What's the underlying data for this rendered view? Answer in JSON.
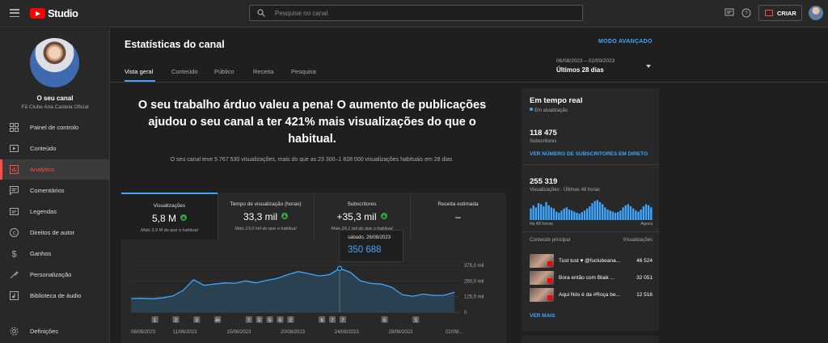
{
  "topbar": {
    "brand": "Studio",
    "search_placeholder": "Pesquise no canal",
    "create_label": "CRIAR"
  },
  "sidebar": {
    "channel_title": "O seu canal",
    "channel_name": "Fã Clube Ana Castela Oficial",
    "items": [
      {
        "label": "Painel de controlo",
        "icon": "dashboard-icon"
      },
      {
        "label": "Conteúdo",
        "icon": "content-icon"
      },
      {
        "label": "Analytics",
        "icon": "analytics-icon"
      },
      {
        "label": "Comentários",
        "icon": "comments-icon"
      },
      {
        "label": "Legendas",
        "icon": "subtitles-icon"
      },
      {
        "label": "Direitos de autor",
        "icon": "copyright-icon"
      },
      {
        "label": "Ganhos",
        "icon": "earn-icon"
      },
      {
        "label": "Personalização",
        "icon": "customization-icon"
      },
      {
        "label": "Biblioteca de áudio",
        "icon": "audio-library-icon"
      }
    ],
    "settings_label": "Definições"
  },
  "header": {
    "title": "Estatísticas do canal",
    "advanced_mode": "MODO AVANÇADO",
    "tabs": [
      "Vista geral",
      "Conteúdo",
      "Público",
      "Receita",
      "Pesquisa"
    ],
    "date_range": "06/08/2023 – 02/09/2023",
    "date_label": "Últimos 28 dias"
  },
  "headline": {
    "title": "O seu trabalho árduo valeu a pena! O aumento de publicações ajudou o seu canal a ter 421% mais visualizações do que o habitual.",
    "subtitle": "O seu canal teve 5 767 530 visualizações, mais do que as 23 300–1 828 000 visualizações habituais em 28 dias"
  },
  "metrics": [
    {
      "label": "Visualizações",
      "value": "5,8 M",
      "note": "Mais 3,9 M do que o habitual"
    },
    {
      "label": "Tempo de visualização (horas)",
      "value": "33,3 mil",
      "note": "Mais 23,0 mil do que o habitual"
    },
    {
      "label": "Subscritores",
      "value": "+35,3 mil",
      "note": "Mais 24,1 mil do que o habitual"
    },
    {
      "label": "Receita estimada",
      "value": "–",
      "note": ""
    }
  ],
  "tooltip": {
    "date": "sábado, 26/08/2023",
    "value": "350 688"
  },
  "chart_data": {
    "type": "area",
    "series": [
      {
        "values": [
          110,
          112,
          108,
          115,
          130,
          175,
          260,
          215,
          225,
          235,
          232,
          250,
          235,
          255,
          270,
          300,
          325,
          310,
          290,
          300,
          350,
          320,
          250,
          230,
          225,
          200,
          140,
          128,
          145,
          135,
          135,
          160
        ]
      }
    ],
    "ylim": [
      0,
      375
    ],
    "yticks": [
      "375,0 mil",
      "250,0 mil",
      "125,0 mil",
      "0"
    ],
    "xticks": [
      "06/08/2023",
      "11/08/2023",
      "15/08/2023",
      "20/08/2023",
      "24/08/2023",
      "29/08/2023",
      "02/09/..."
    ],
    "markers": [
      "1",
      "2",
      "3",
      "4+",
      "7",
      "5",
      "5",
      "6",
      "2",
      "6",
      "7",
      "7",
      "6",
      "1"
    ],
    "highlight_index": 20,
    "color": "#3ea6ff"
  },
  "realtime": {
    "title": "Em tempo real",
    "status": "Em atualização",
    "subscribers_value": "118 475",
    "subscribers_label": "Subscritores",
    "live_subs_link": "VER NÚMERO DE SUBSCRITORES EM DIRETO",
    "views_value": "255 319",
    "views_label": "Visualizações · Últimas 48 horas",
    "axis_left": "há 48 horas",
    "axis_right": "Agora",
    "bars": [
      55,
      70,
      60,
      80,
      75,
      65,
      85,
      70,
      60,
      55,
      40,
      35,
      45,
      55,
      60,
      50,
      45,
      40,
      35,
      30,
      38,
      45,
      55,
      65,
      80,
      90,
      95,
      85,
      75,
      60,
      50,
      45,
      40,
      35,
      38,
      45,
      60,
      70,
      75,
      65,
      55,
      45,
      40,
      50,
      65,
      75,
      70,
      60
    ],
    "col_content": "Conteúdo principal",
    "col_views": "Visualizações",
    "top_content": [
      {
        "title": "Tust tust ♥ @fuclubeana...",
        "views": "46 524"
      },
      {
        "title": "Bora então com Blaik ...",
        "views": "32 051"
      },
      {
        "title": "Aqui Nós é da #Roça be...",
        "views": "12 516"
      }
    ],
    "more_link": "VER MAIS"
  }
}
